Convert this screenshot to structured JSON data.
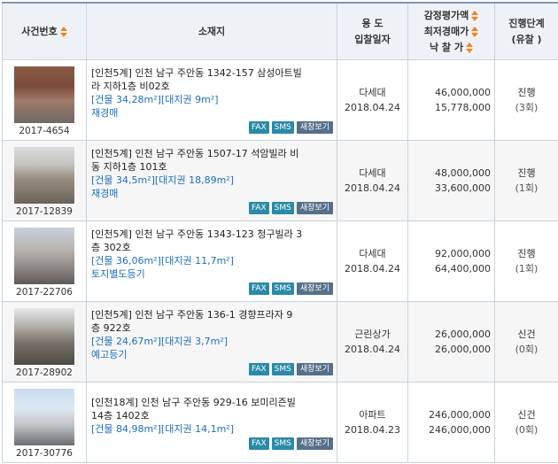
{
  "headers": {
    "case_no": "사건번호",
    "address": "소재지",
    "use_line1": "용 도",
    "use_line2": "입찰일자",
    "price_line1": "감정평가액",
    "price_line2": "최저경매가",
    "price_line3": "낙 찰 가",
    "stage_line1": "진행단계",
    "stage_line2": "(유찰 )"
  },
  "buttons": {
    "fax": "FAX",
    "sms": "SMS",
    "popup": "새창보기"
  },
  "rows": [
    {
      "case_no": "2017-4654",
      "addr_line1": "[인천5계] 인천 남구 주안동 1342-157 삼성아트빌",
      "addr_line2": "라 지하1층 비02호",
      "area": "[건물 34,28m²][대지권 9m²]",
      "sale_type": "재경매",
      "use": "다세대",
      "date": "2018.04.24",
      "appraisal": "46,000,000",
      "min_price": "15,778,000",
      "stage": "진행",
      "fails": "(3회)"
    },
    {
      "case_no": "2017-12839",
      "addr_line1": "[인천5계] 인천 남구 주안동 1507-17 석암빌라 비",
      "addr_line2": "동 지하1층 101호",
      "area": "[건물 34,5m²][대지권 18,89m²]",
      "sale_type": "재경매",
      "use": "다세대",
      "date": "2018.04.24",
      "appraisal": "48,000,000",
      "min_price": "33,600,000",
      "stage": "진행",
      "fails": "(1회)"
    },
    {
      "case_no": "2017-22706",
      "addr_line1": "[인천5계] 인천 남구 주안동 1343-123 청구빌라 3",
      "addr_line2": "층 302호",
      "area": "[건물 36,06m²][대지권 11,7m²]",
      "sale_type": "토지별도등기",
      "use": "다세대",
      "date": "2018.04.24",
      "appraisal": "92,000,000",
      "min_price": "64,400,000",
      "stage": "진행",
      "fails": "(1회)"
    },
    {
      "case_no": "2017-28902",
      "addr_line1": "[인천5계] 인천 남구 주안동 136-1 경향프라자 9",
      "addr_line2": "층 922호",
      "area": "[건물 24,67m²][대지권 3,7m²]",
      "sale_type": "예고등기",
      "use": "근린상가",
      "date": "2018.04.24",
      "appraisal": "26,000,000",
      "min_price": "26,000,000",
      "stage": "신건",
      "fails": "(0회)"
    },
    {
      "case_no": "2017-30776",
      "addr_line1": "[인천18계] 인천 남구 주안동 929-16 보미리즌빌",
      "addr_line2": "14층 1402호",
      "area": "[건물 84,98m²][대지권 14,1m²]",
      "sale_type": "",
      "use": "아파트",
      "date": "2018.04.23",
      "appraisal": "246,000,000",
      "min_price": "246,000,000",
      "stage": "신건",
      "fails": "(0회)"
    }
  ]
}
